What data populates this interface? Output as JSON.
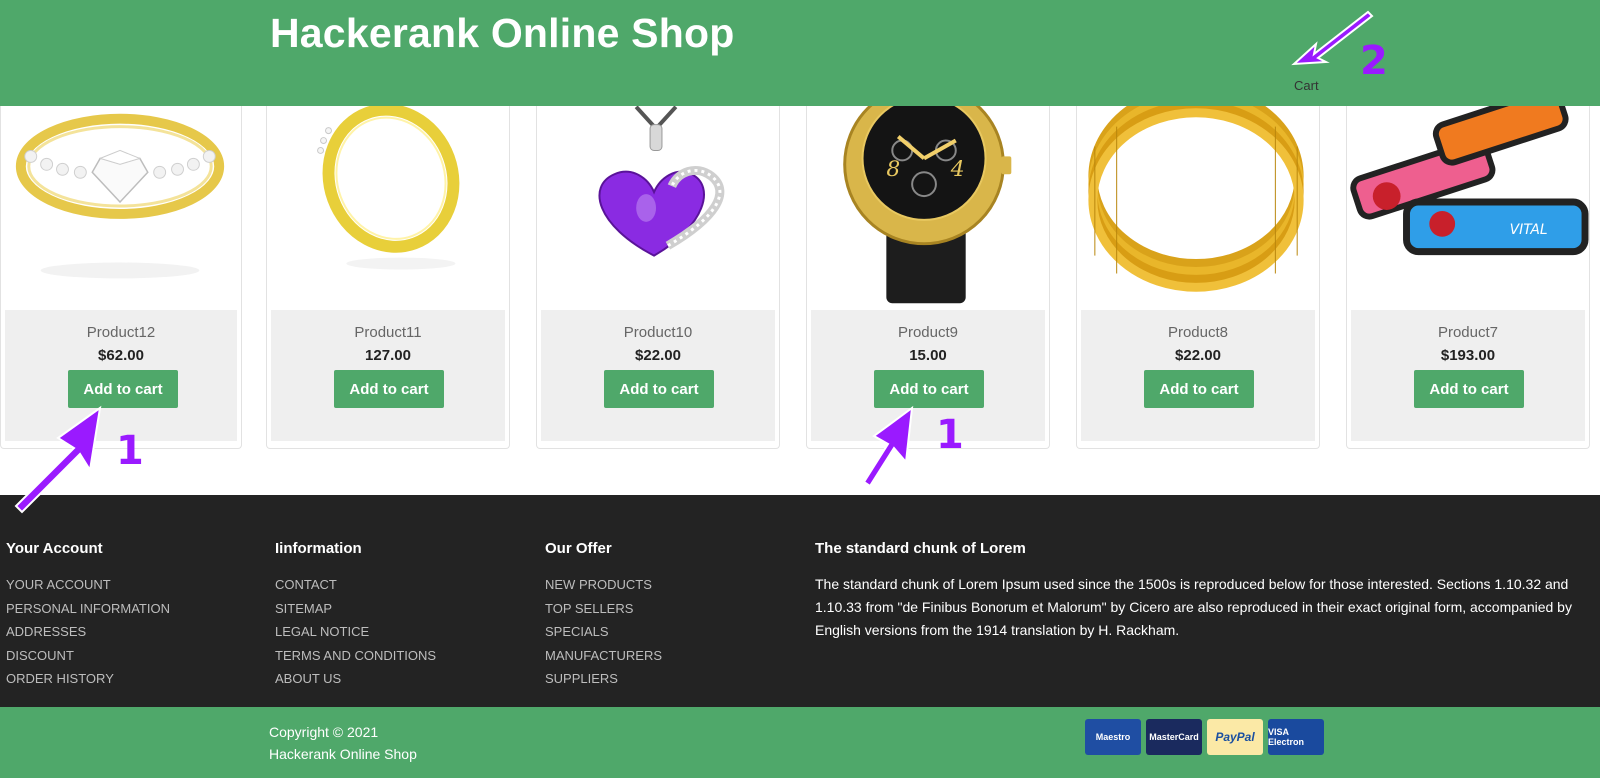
{
  "header": {
    "title": "Hackerank Online Shop",
    "cart_label": "Cart"
  },
  "products": [
    {
      "name": "Product12",
      "price": "$62.00",
      "button": "Add to cart",
      "image": "diamond-ring"
    },
    {
      "name": "Product11",
      "price": "127.00",
      "button": "Add to cart",
      "image": "gold-ring"
    },
    {
      "name": "Product10",
      "price": "$22.00",
      "button": "Add to cart",
      "image": "heart-pendant"
    },
    {
      "name": "Product9",
      "price": "15.00",
      "button": "Add to cart",
      "image": "gold-watch"
    },
    {
      "name": "Product8",
      "price": "$22.00",
      "button": "Add to cart",
      "image": "gold-bangles"
    },
    {
      "name": "Product7",
      "price": "$193.00",
      "button": "Add to cart",
      "image": "wristbands"
    }
  ],
  "footer": {
    "account": {
      "title": "Your Account",
      "links": [
        "YOUR ACCOUNT",
        "PERSONAL INFORMATION",
        "ADDRESSES",
        "DISCOUNT",
        "ORDER HISTORY"
      ]
    },
    "information": {
      "title": "Iinformation",
      "links": [
        "CONTACT",
        "SITEMAP",
        "LEGAL NOTICE",
        "TERMS AND CONDITIONS",
        "ABOUT US"
      ]
    },
    "offer": {
      "title": "Our Offer",
      "links": [
        "NEW PRODUCTS",
        "TOP SELLERS",
        "SPECIALS",
        "MANUFACTURERS",
        "SUPPLIERS"
      ]
    },
    "lorem": {
      "title": "The standard chunk of Lorem",
      "text": "The standard chunk of Lorem Ipsum used since the 1500s is reproduced below for those interested. Sections 1.10.32 and 1.10.33 from \"de Finibus Bonorum et Malorum\" by Cicero are also reproduced in their exact original form, accompanied by English versions from the 1914 translation by H. Rackham."
    }
  },
  "bottom": {
    "copyright": "Copyright © 2021",
    "shop_name": "Hackerank Online Shop",
    "payments": [
      "Maestro",
      "MasterCard",
      "PayPal",
      "VISA Electron"
    ]
  },
  "annotations": {
    "left_arrow_label": "1",
    "middle_arrow_label": "1",
    "cart_arrow_label": "2"
  },
  "colors": {
    "brand_green": "#4fa86a",
    "footer_dark": "#232323",
    "annotation_purple": "#9a1aff"
  }
}
